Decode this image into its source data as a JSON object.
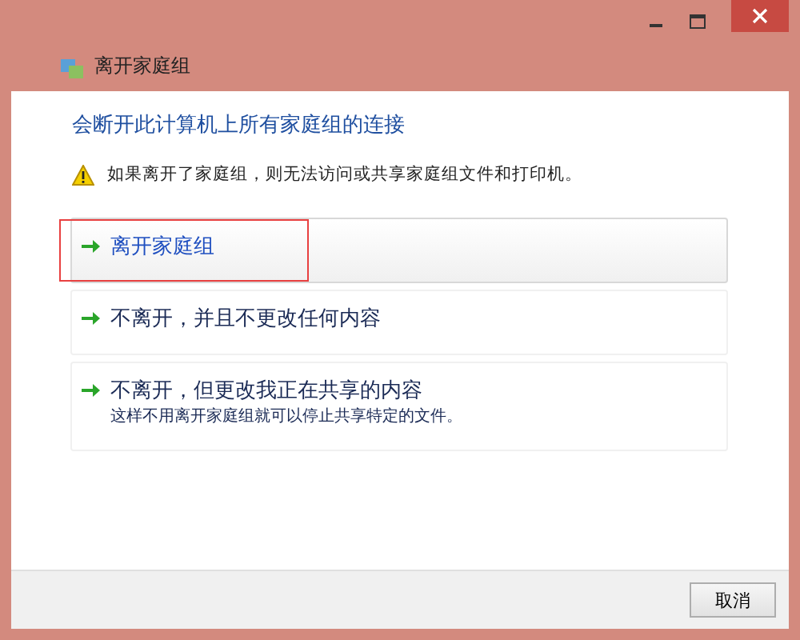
{
  "window": {
    "title": "离开家庭组"
  },
  "heading": "会断开此计算机上所有家庭组的连接",
  "warning": "如果离开了家庭组，则无法访问或共享家庭组文件和打印机。",
  "options": [
    {
      "label": "离开家庭组",
      "selected": true,
      "highlighted": true
    },
    {
      "label": "不离开，并且不更改任何内容",
      "selected": false,
      "highlighted": false
    },
    {
      "label": "不离开，但更改我正在共享的内容",
      "description": "这样不用离开家庭组就可以停止共享特定的文件。",
      "selected": false,
      "highlighted": false
    }
  ],
  "buttons": [
    "取消"
  ]
}
